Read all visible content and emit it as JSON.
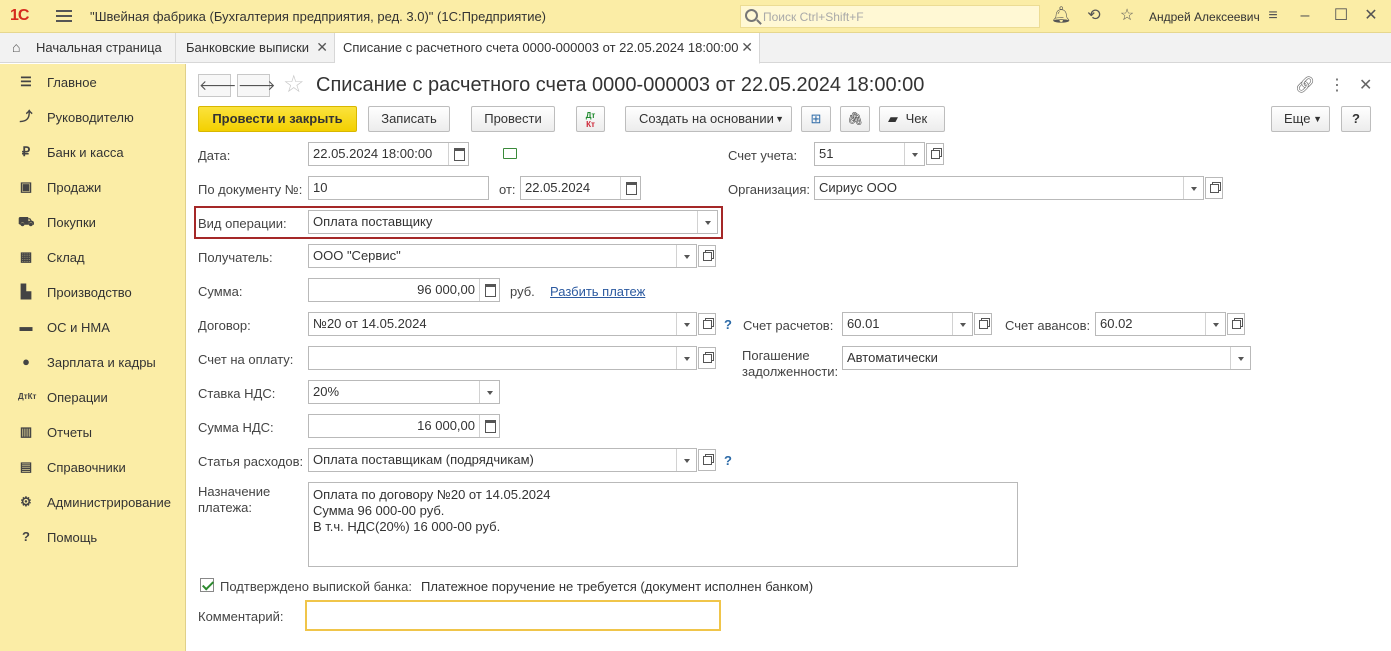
{
  "app": {
    "logo": "1С",
    "title": "\"Швейная фабрика (Бухгалтерия предприятия, ред. 3.0)\"  (1С:Предприятие)",
    "search_placeholder": "Поиск Ctrl+Shift+F",
    "user": "Андрей Алексеевич"
  },
  "tabs": [
    {
      "label": "Начальная страница"
    },
    {
      "label": "Банковские выписки"
    },
    {
      "label": "Списание с расчетного счета 0000-000003 от 22.05.2024 18:00:00"
    }
  ],
  "sidebar": {
    "items": [
      {
        "label": "Главное",
        "icon": "menu-icon"
      },
      {
        "label": "Руководителю",
        "icon": "trend-icon"
      },
      {
        "label": "Банк и касса",
        "icon": "ruble-icon"
      },
      {
        "label": "Продажи",
        "icon": "bag-icon"
      },
      {
        "label": "Покупки",
        "icon": "cart-icon"
      },
      {
        "label": "Склад",
        "icon": "warehouse-icon"
      },
      {
        "label": "Производство",
        "icon": "factory-icon"
      },
      {
        "label": "ОС и НМА",
        "icon": "truck-icon"
      },
      {
        "label": "Зарплата и кадры",
        "icon": "person-icon"
      },
      {
        "label": "Операции",
        "icon": "dt-kt-icon"
      },
      {
        "label": "Отчеты",
        "icon": "chart-icon"
      },
      {
        "label": "Справочники",
        "icon": "book-icon"
      },
      {
        "label": "Администрирование",
        "icon": "gear-icon"
      },
      {
        "label": "Помощь",
        "icon": "help-icon"
      }
    ]
  },
  "document": {
    "title": "Списание с расчетного счета 0000-000003 от 22.05.2024 18:00:00",
    "toolbar": {
      "post_close": "Провести и закрыть",
      "save": "Записать",
      "post": "Провести",
      "create_based": "Создать на основании",
      "check": "Чек",
      "more": "Еще",
      "help": "?"
    },
    "fields": {
      "date_label": "Дата:",
      "date_value": "22.05.2024 18:00:00",
      "doc_no_label": "По документу №:",
      "doc_no_value": "10",
      "from_label": "от:",
      "from_value": "22.05.2024",
      "op_type_label": "Вид операции:",
      "op_type_value": "Оплата поставщику",
      "recipient_label": "Получатель:",
      "recipient_value": "ООО \"Сервис\"",
      "sum_label": "Сумма:",
      "sum_value": "96 000,00",
      "currency": "руб.",
      "split_link": "Разбить платеж",
      "contract_label": "Договор:",
      "contract_value": "№20 от 14.05.2024",
      "invoice_label": "Счет на оплату:",
      "invoice_value": "",
      "vat_rate_label": "Ставка НДС:",
      "vat_rate_value": "20%",
      "vat_sum_label": "Сумма НДС:",
      "vat_sum_value": "16 000,00",
      "expense_label": "Статья расходов:",
      "expense_value": "Оплата поставщикам (подрядчикам)",
      "purpose_label_1": "Назначение",
      "purpose_label_2": "платежа:",
      "purpose_line1": "Оплата по договору №20 от 14.05.2024",
      "purpose_line2": "Сумма 96 000-00 руб.",
      "purpose_line3": "В т.ч. НДС(20%) 16 000-00 руб.",
      "confirmed_label": "Подтверждено выпиской банка:",
      "confirmed_text": "Платежное поручение не требуется (документ исполнен банком)",
      "comment_label": "Комментарий:",
      "comment_value": "",
      "account_label": "Счет учета:",
      "account_value": "51",
      "org_label": "Организация:",
      "org_value": "Сириус ООО",
      "settle_label": "Счет расчетов:",
      "settle_value": "60.01",
      "advance_label": "Счет авансов:",
      "advance_value": "60.02",
      "repay_label_1": "Погашение",
      "repay_label_2": "задолженности:",
      "repay_value": "Автоматически",
      "help_mark": "?"
    }
  }
}
